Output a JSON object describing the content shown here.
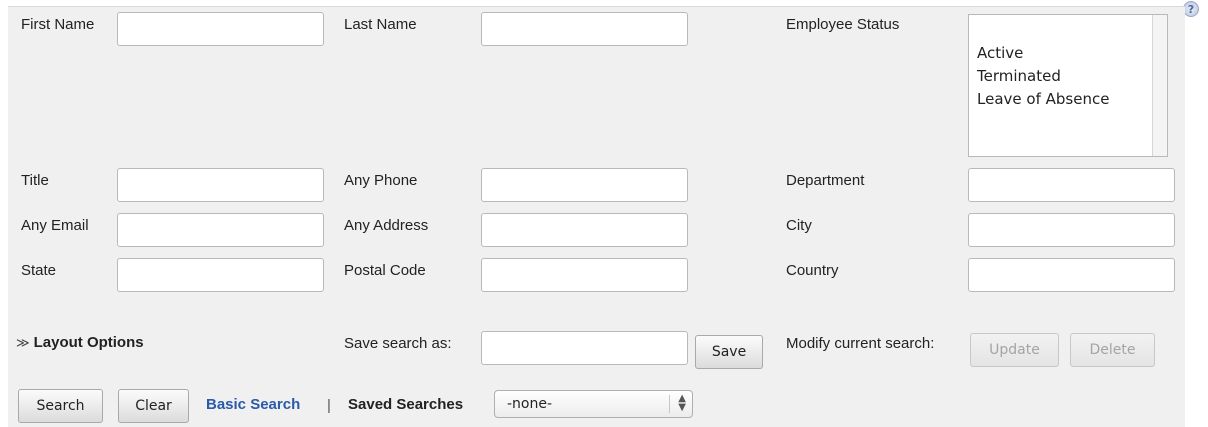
{
  "help": {
    "glyph": "?"
  },
  "fields": {
    "first_name": {
      "label": "First Name",
      "value": ""
    },
    "last_name": {
      "label": "Last Name",
      "value": ""
    },
    "employee_status": {
      "label": "Employee Status",
      "options": [
        "Active",
        "Terminated",
        "Leave of Absence"
      ]
    },
    "title": {
      "label": "Title",
      "value": ""
    },
    "any_phone": {
      "label": "Any Phone",
      "value": ""
    },
    "department": {
      "label": "Department",
      "value": ""
    },
    "any_email": {
      "label": "Any Email",
      "value": ""
    },
    "any_address": {
      "label": "Any Address",
      "value": ""
    },
    "city": {
      "label": "City",
      "value": ""
    },
    "state": {
      "label": "State",
      "value": ""
    },
    "postal_code": {
      "label": "Postal Code",
      "value": ""
    },
    "country": {
      "label": "Country",
      "value": ""
    }
  },
  "layout_options": {
    "icon": "chevron-double-down-icon",
    "glyph": "≫",
    "label": "Layout Options"
  },
  "save_search": {
    "label": "Save search as:",
    "value": "",
    "button": "Save"
  },
  "modify_search": {
    "label": "Modify current search:",
    "update": "Update",
    "delete": "Delete"
  },
  "footer": {
    "search": "Search",
    "clear": "Clear",
    "basic_search": "Basic Search",
    "separator": "|",
    "saved_searches_label": "Saved Searches",
    "saved_searches_value": "-none-"
  },
  "colors": {
    "panel": "#f0f0f0",
    "link": "#2a5aa8",
    "disabled_text": "#a4a4a4"
  }
}
